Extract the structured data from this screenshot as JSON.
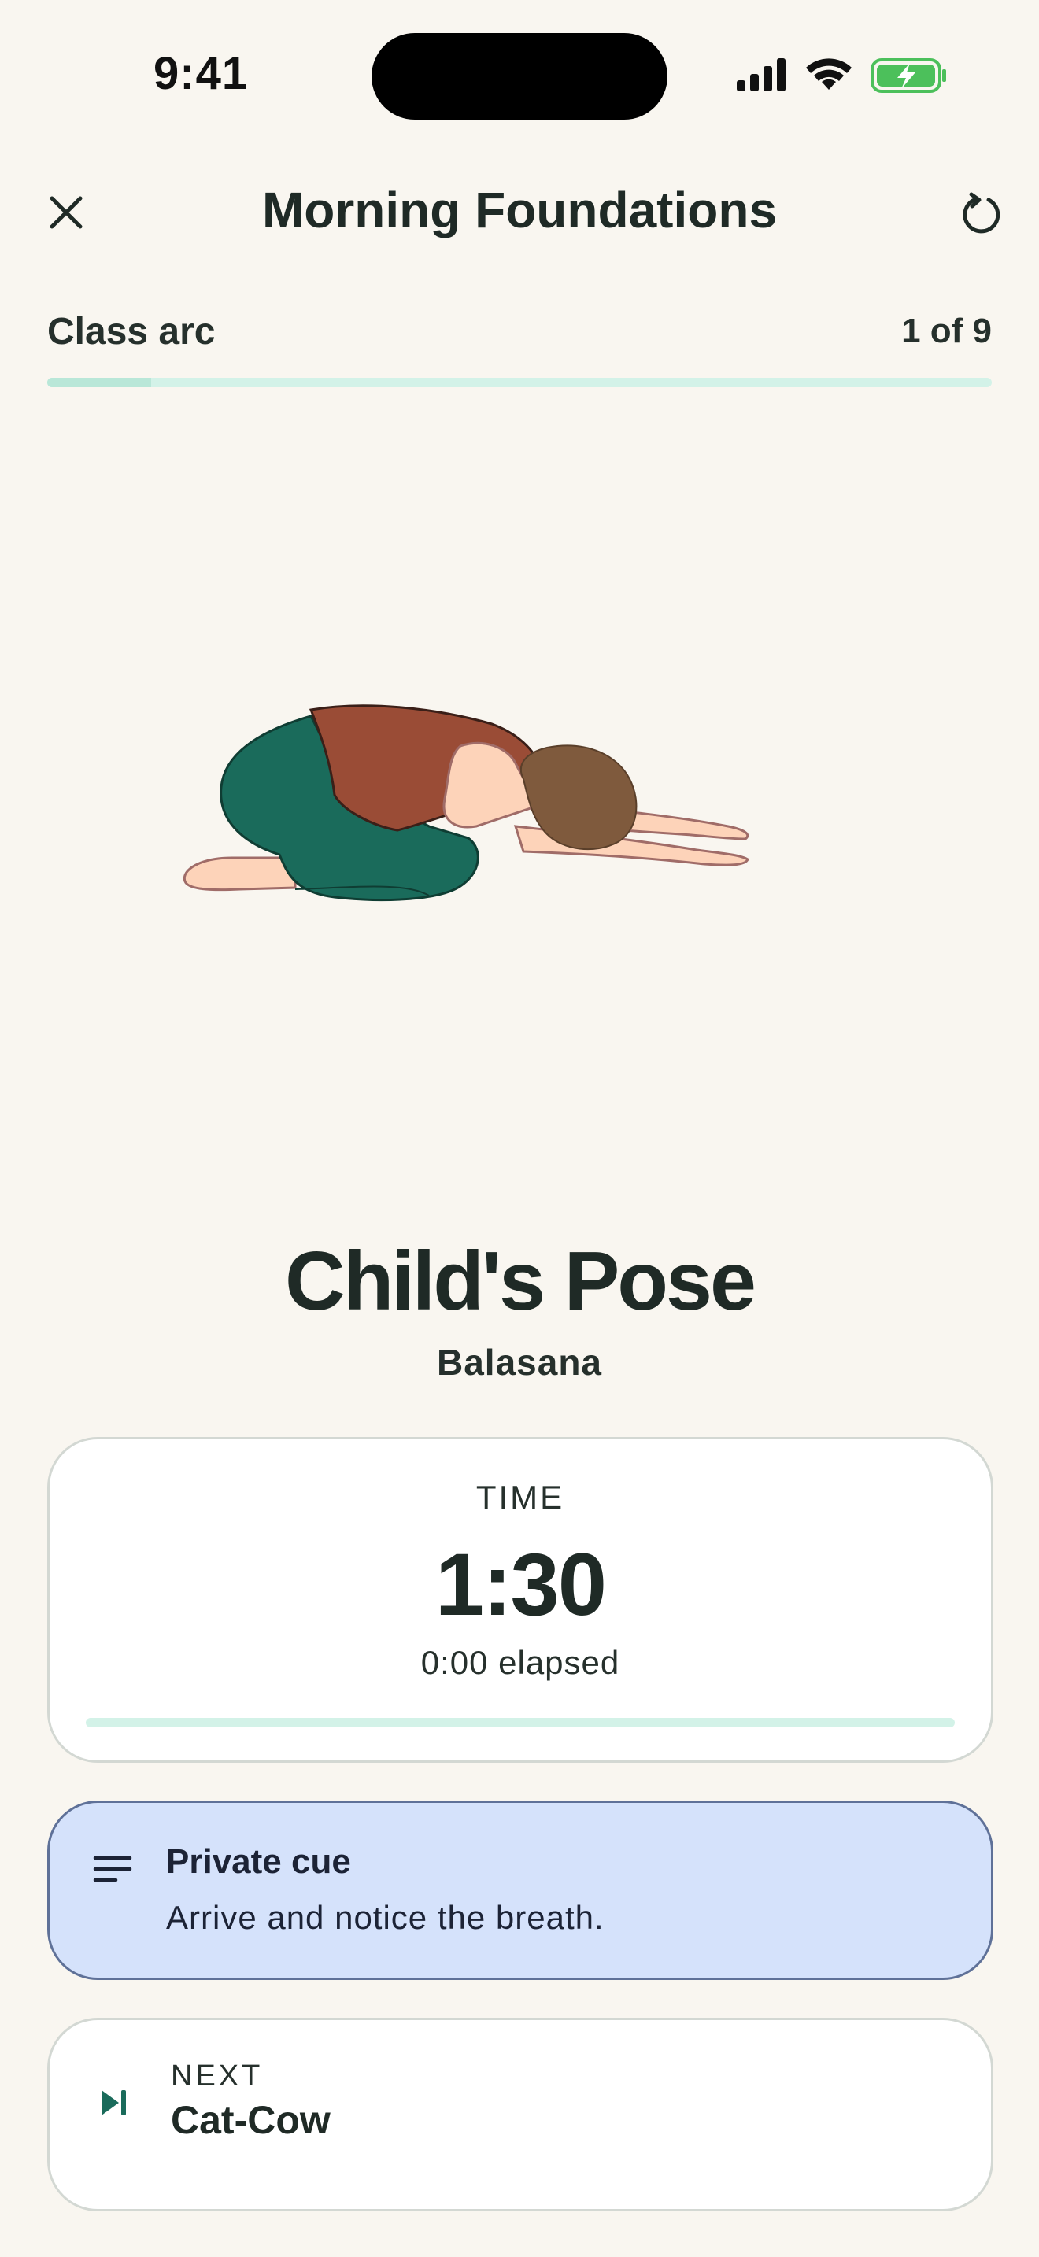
{
  "status_bar": {
    "time": "9:41"
  },
  "header": {
    "title": "Morning Foundations",
    "close_icon": "close-icon",
    "restart_icon": "restart-icon"
  },
  "class_arc": {
    "label": "Class arc",
    "count": "1 of 9",
    "progress": 0.11
  },
  "pose": {
    "name": "Child's Pose",
    "sanskrit": "Balasana",
    "illustration": "childs-pose-illustration"
  },
  "timer": {
    "label": "TIME",
    "value": "1:30",
    "elapsed": "0:00 elapsed",
    "progress": 0
  },
  "cue": {
    "icon": "notes-icon",
    "title": "Private cue",
    "text": "Arrive and notice the breath."
  },
  "next": {
    "icon": "skip-next-icon",
    "label": "NEXT",
    "name": "Cat-Cow"
  },
  "colors": {
    "background": "#f9f6f0",
    "accent": "#1a6b5b",
    "track": "#d3f2e8",
    "cue_bg": "#d5e2fb",
    "cue_border": "#5f7198"
  }
}
